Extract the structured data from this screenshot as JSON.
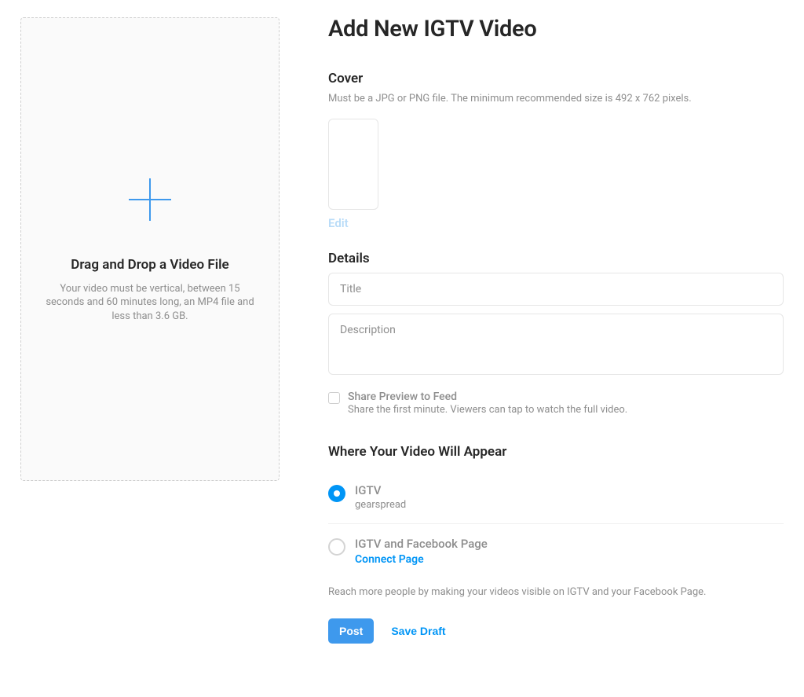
{
  "page_title": "Add New IGTV Video",
  "dropzone": {
    "heading": "Drag and Drop a Video File",
    "description": "Your video must be vertical, between 15 seconds and 60 minutes long, an MP4 file and less than 3.6 GB."
  },
  "cover": {
    "section_title": "Cover",
    "helper": "Must be a JPG or PNG file. The minimum recommended size is 492 x 762 pixels.",
    "edit_label": "Edit"
  },
  "details": {
    "section_title": "Details",
    "title_placeholder": "Title",
    "description_placeholder": "Description",
    "title_value": "",
    "description_value": ""
  },
  "share_preview": {
    "label": "Share Preview to Feed",
    "sub": "Share the first minute. Viewers can tap to watch the full video.",
    "checked": false
  },
  "appear": {
    "section_title": "Where Your Video Will Appear",
    "options": [
      {
        "label": "IGTV",
        "sub": "gearspread",
        "selected": true
      },
      {
        "label": "IGTV and Facebook Page",
        "link": "Connect Page",
        "selected": false
      }
    ],
    "reach_text": "Reach more people by making your videos visible on IGTV and your Facebook Page."
  },
  "actions": {
    "post_label": "Post",
    "save_draft_label": "Save Draft"
  },
  "colors": {
    "accent": "#0095f6",
    "button": "#3E99ED",
    "muted": "#8e8e8e"
  }
}
